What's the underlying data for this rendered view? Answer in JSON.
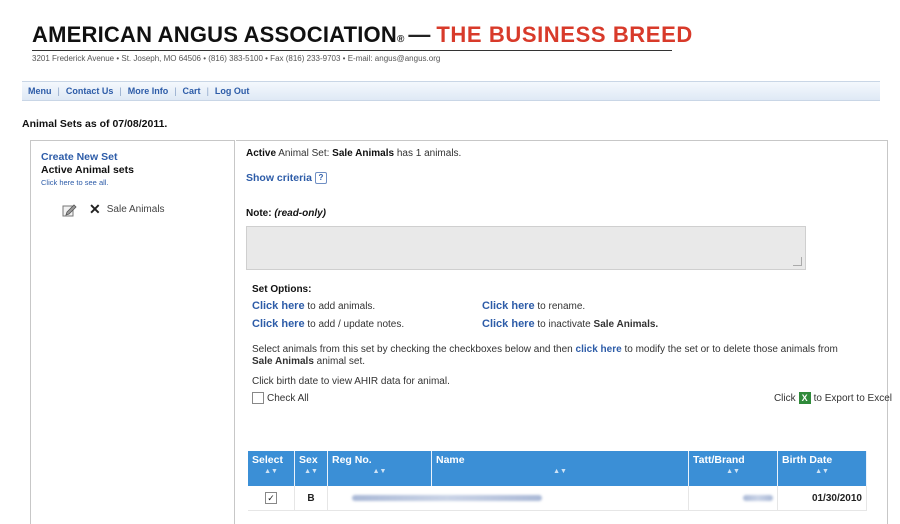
{
  "header": {
    "title": "AMERICAN ANGUS ASSOCIATION",
    "registered": "®",
    "dash": "—",
    "tagline": "THE BUSINESS BREED",
    "address": "3201 Frederick Avenue • St. Joseph, MO 64506 • (816) 383-5100 • Fax (816) 233-9703 • E-mail: angus@angus.org"
  },
  "nav": {
    "items": [
      "Menu",
      "Contact Us",
      "More Info",
      "Cart",
      "Log Out"
    ],
    "separator": "|"
  },
  "page": {
    "heading": "Animal Sets as of 07/08/2011."
  },
  "sidebar": {
    "create_new": "Create New Set",
    "active_sets_label": "Active Animal sets",
    "see_all": "Click here to see all.",
    "set_name": "Sale Animals"
  },
  "main": {
    "active_prefix": "Active",
    "active_mid": "Animal Set:",
    "active_set": "Sale Animals",
    "active_suffix": "has 1 animals.",
    "show_criteria": "Show criteria",
    "criteria_icon": "?",
    "note_label": "Note:",
    "note_readonly": "(read-only)",
    "set_options_title": "Set Options:",
    "click_here": "Click here",
    "opt_add_animals": "to add animals.",
    "opt_rename": "to rename.",
    "opt_add_notes": "to add / update notes.",
    "opt_inactivate_prefix": "to inactivate",
    "opt_inactivate_set": "Sale Animals.",
    "select_instr_1": "Select animals from this set by checking the checkboxes below and then",
    "select_instr_link": "click here",
    "select_instr_2": "to modify the set or to delete those animals from",
    "select_instr_set": "Sale Animals",
    "select_instr_3": "animal set.",
    "birth_instr": "Click birth date to view AHIR data for animal.",
    "check_all": "Check All",
    "export_prefix": "Click",
    "export_suffix": "to Export to Excel",
    "excel_icon": "X"
  },
  "table": {
    "headers": [
      "Select",
      "Sex",
      "Reg No.",
      "Name",
      "Tatt/Brand",
      "Birth Date"
    ],
    "sort_glyph": "▲▼",
    "rows": [
      {
        "select": "✓",
        "sex": "B",
        "birth_date": "01/30/2010"
      }
    ]
  },
  "colors": {
    "brand_red": "#d83a2a",
    "link_blue": "#2d5ca8",
    "table_header": "#3b8fd6"
  }
}
